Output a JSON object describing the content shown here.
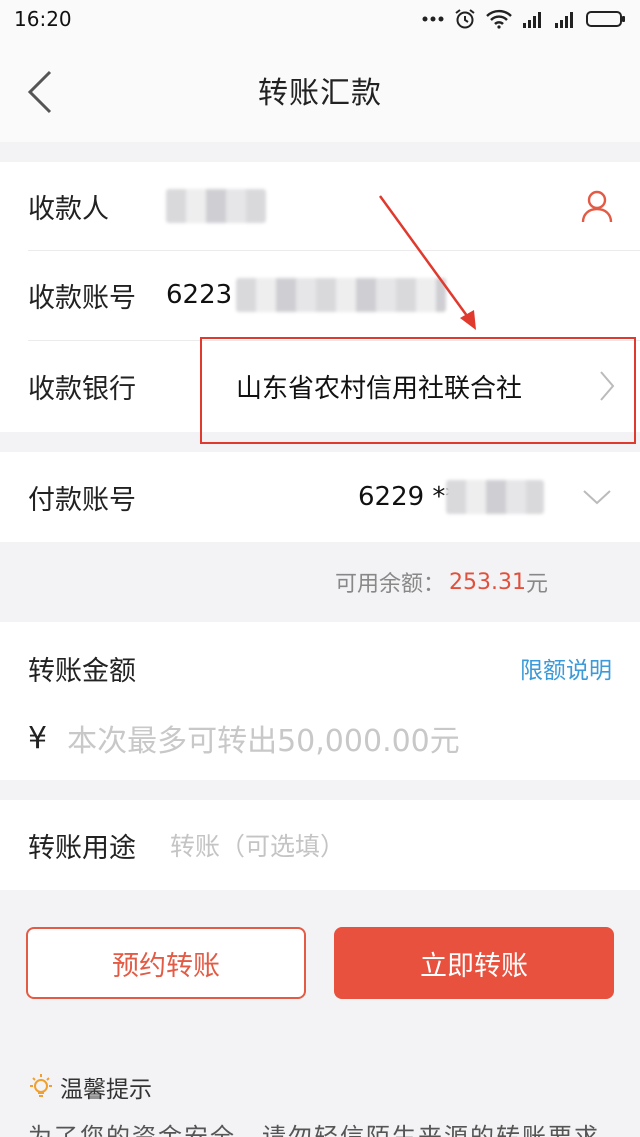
{
  "status_bar": {
    "time": "16:20"
  },
  "header": {
    "title": "转账汇款"
  },
  "payee": {
    "name_label": "收款人",
    "account_label": "收款账号",
    "account_prefix": "6223",
    "bank_label": "收款银行",
    "bank_value": "山东省农村信用社联合社"
  },
  "payer": {
    "account_label": "付款账号",
    "account_prefix": "6229 **",
    "balance_label": "可用余额：",
    "balance_amount": "253.31",
    "balance_unit": "元"
  },
  "amount": {
    "label": "转账金额",
    "limit_link": "限额说明",
    "currency_symbol": "¥",
    "placeholder": "本次最多可转出50,000.00元"
  },
  "purpose": {
    "label": "转账用途",
    "placeholder": "转账（可选填）"
  },
  "buttons": {
    "schedule": "预约转账",
    "transfer_now": "立即转账"
  },
  "tips": {
    "title": "温馨提示",
    "text": "为了您的资金安全，请勿轻信陌生来源的转账要求"
  },
  "colors": {
    "accent": "#e8513e",
    "link": "#3c9ad8",
    "annotation": "#e03a2e"
  }
}
